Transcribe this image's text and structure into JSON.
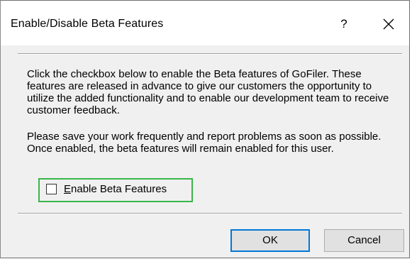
{
  "dialog": {
    "title": "Enable/Disable Beta Features",
    "help_label": "?",
    "close_icon": "close-icon"
  },
  "content": {
    "paragraph1": "Click the checkbox below to enable the Beta features of GoFiler. These features are released in advance to give our customers the opportunity to utilize the added functionality and to enable our development team to receive customer feedback.",
    "paragraph2": "Please save your work frequently and report problems as soon as possible. Once enabled, the beta features will remain enabled for this user."
  },
  "checkbox": {
    "mnemonic": "E",
    "label_rest": "nable Beta Features",
    "checked": false,
    "highlight_color": "#39b54a"
  },
  "buttons": {
    "ok_label": "OK",
    "cancel_label": "Cancel",
    "default_border_color": "#0078d7"
  }
}
